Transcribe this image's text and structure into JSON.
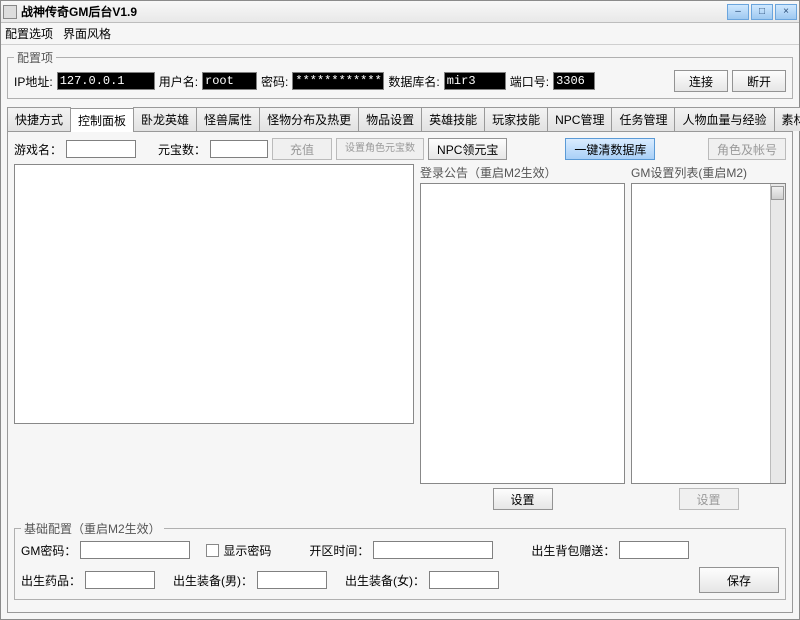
{
  "window": {
    "title": "战神传奇GM后台V1.9"
  },
  "menu": {
    "options": "配置选项",
    "theme": "界面风格"
  },
  "config": {
    "legend": "配置项",
    "ip_label": "IP地址:",
    "ip_value": "127.0.0.1",
    "user_label": "用户名:",
    "user_value": "root",
    "pass_label": "密码:",
    "pass_value": "************",
    "db_label": "数据库名:",
    "db_value": "mir3",
    "port_label": "端口号:",
    "port_value": "3306",
    "connect": "连接",
    "disconnect": "断开"
  },
  "tabs": [
    "快捷方式",
    "控制面板",
    "卧龙英雄",
    "怪兽属性",
    "怪物分布及热更",
    "物品设置",
    "英雄技能",
    "玩家技能",
    "NPC管理",
    "任务管理",
    "人物血量与经验",
    "素材热更"
  ],
  "active_tab_index": 1,
  "panel": {
    "game_label": "游戏名：",
    "game_value": "",
    "gold_label": "元宝数：",
    "gold_value": "",
    "recharge": "充值",
    "set_char_gold": "设置角色元宝数",
    "npc_gold": "NPC领元宝",
    "clear_db": "一键清数据库",
    "char_account": "角色及帐号",
    "notice_legend": "登录公告（重启M2生效）",
    "gmlist_legend": "GM设置列表(重启M2)",
    "set_btn": "设置"
  },
  "base": {
    "legend": "基础配置（重启M2生效）",
    "gmpass_label": "GM密码：",
    "gmpass_value": "",
    "showpass_label": "显示密码",
    "opentime_label": "开区时间：",
    "opentime_value": "",
    "bag_label": "出生背包赠送：",
    "bag_value": "",
    "med_label": "出生药品：",
    "med_value": "",
    "equip_m_label": "出生装备(男)：",
    "equip_m_value": "",
    "equip_f_label": "出生装备(女)：",
    "equip_f_value": "",
    "save": "保存"
  }
}
